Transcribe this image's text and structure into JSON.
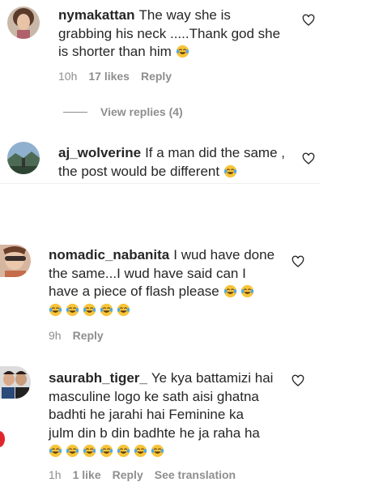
{
  "comments": [
    {
      "username": "nymakattan",
      "text": "The way she is grabbing his neck .....Thank god she is shorter than him",
      "line1": "The way she is",
      "line2": "grabbing his neck .....Thank god she",
      "line3": "is shorter than him",
      "time": "10h",
      "likes": "17 likes",
      "reply": "Reply",
      "view_replies": "View replies (4)"
    },
    {
      "username": "aj_wolverine",
      "line1": "If a man did the same ,",
      "line2": "the post would be different"
    },
    {
      "username": "nomadic_nabanita",
      "line1": "I wud have done",
      "line2": "the same...I wud have said can I",
      "line3": "have a piece of flash please",
      "time": "9h",
      "reply": "Reply"
    },
    {
      "username": "saurabh_tiger_",
      "line1": "Ye kya battamizi hai",
      "line2": "masculine logo ke sath aisi ghatna",
      "line3": "badhti he jarahi hai Feminine ka",
      "line4": "julm din b din badhte he ja raha ha",
      "time": "1h",
      "likes": "1 like",
      "reply": "Reply",
      "see_translation": "See translation"
    }
  ],
  "icons": {
    "heart": "heart-outline-icon",
    "emoji": "face-with-tears-of-joy-emoji"
  },
  "colors": {
    "text": "#262626",
    "meta": "#8e8e8e",
    "emoji_face": "#f7c43a"
  }
}
